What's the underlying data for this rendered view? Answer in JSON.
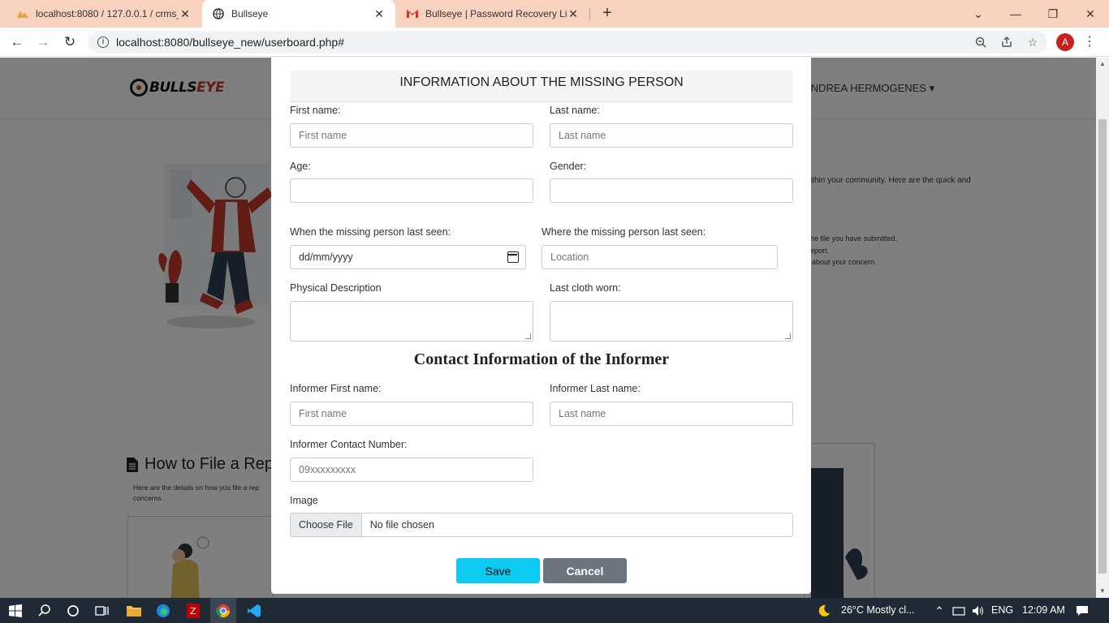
{
  "browser": {
    "tabs": [
      {
        "title": "localhost:8080 / 127.0.0.1 / crms_",
        "icon": "phpmyadmin-icon"
      },
      {
        "title": "Bullseye",
        "icon": "globe-icon"
      },
      {
        "title": "Bullseye | Password Recovery Link",
        "icon": "gmail-icon"
      }
    ],
    "url": "localhost:8080/bullseye_new/userboard.php#",
    "profile_initial": "A"
  },
  "site": {
    "logo_text": "BULLS",
    "logo_accent": "EYE",
    "user_name": "ANDREA HERMOGENES",
    "bg_text_1": "ithin your community. Here are the quick and",
    "bg_text_2": "he file you have submitted.",
    "bg_text_3": "eport.",
    "bg_text_4": "about your concern.",
    "how_title": "How to File a Repo",
    "how_sub": "Here are the details on how you file a rep concerns."
  },
  "modal": {
    "header": "INFORMATION ABOUT THE MISSING PERSON",
    "first_name_label": "First name:",
    "first_name_placeholder": "First name",
    "last_name_label": "Last name:",
    "last_name_placeholder": "Last name",
    "age_label": "Age:",
    "gender_label": "Gender:",
    "last_seen_date_label": "When the missing person last seen:",
    "last_seen_date_placeholder": "dd/mm/yyyy",
    "last_seen_place_label": "Where the missing person last seen:",
    "last_seen_place_placeholder": "Location",
    "physical_label": "Physical Description",
    "cloth_label": "Last cloth worn:",
    "contact_title": "Contact Information of the Informer",
    "inf_first_label": "Informer First name:",
    "inf_first_placeholder": "First name",
    "inf_last_label": "Informer Last name:",
    "inf_last_placeholder": "Last name",
    "inf_contact_label": "Informer Contact Number:",
    "inf_contact_placeholder": "09xxxxxxxxx",
    "image_label": "Image",
    "choose_file": "Choose File",
    "no_file": "No file chosen",
    "save": "Save",
    "cancel": "Cancel"
  },
  "taskbar": {
    "weather": "26°C  Mostly cl...",
    "lang": "ENG",
    "time": "12:09 AM"
  },
  "colors": {
    "tab_strip": "#f7d3bf",
    "save_button": "#0dcaf0",
    "cancel_button": "#6c757d",
    "taskbar": "#1f2a36"
  }
}
